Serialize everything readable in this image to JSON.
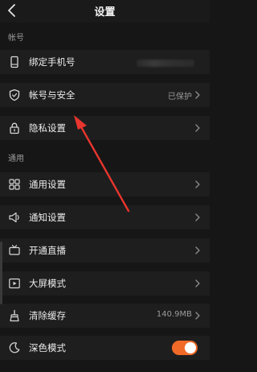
{
  "header": {
    "title": "设置",
    "back_icon": "chevron-left-icon"
  },
  "sections": {
    "account": "帐号",
    "general": "通用"
  },
  "account_items": [
    {
      "label": "绑定手机号",
      "icon": "phone-icon"
    },
    {
      "label": "帐号与安全",
      "value": "已保护",
      "icon": "shield-icon"
    },
    {
      "label": "隐私设置",
      "icon": "lock-icon"
    }
  ],
  "general_items": [
    {
      "label": "通用设置",
      "icon": "grid-icon"
    },
    {
      "label": "通知设置",
      "icon": "speaker-icon"
    },
    {
      "label": "开通直播",
      "icon": "broadcast-icon"
    },
    {
      "label": "大屏模式",
      "icon": "screen-play-icon"
    },
    {
      "label": "清除缓存",
      "value": "140.9MB",
      "icon": "broom-icon"
    },
    {
      "label": "深色模式",
      "icon": "moon-icon",
      "toggle_on": true
    }
  ],
  "colors": {
    "background": "#161616",
    "row": "#1e1e1e",
    "accent": "#f26a28",
    "annotation_arrow": "#e8362e"
  }
}
